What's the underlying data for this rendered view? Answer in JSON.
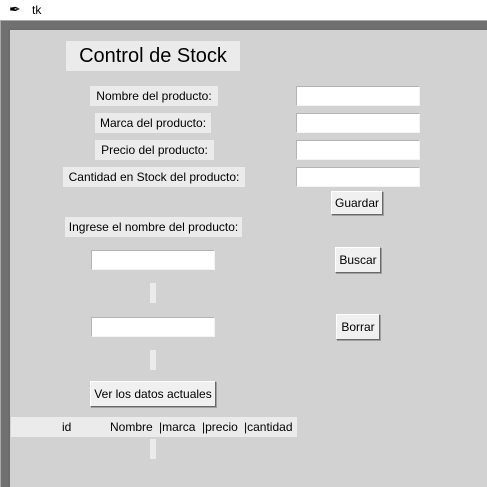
{
  "window": {
    "title": "tk",
    "icon": "feather-icon"
  },
  "form": {
    "title": "Control de Stock",
    "labels": {
      "nombre": "Nombre del producto:",
      "marca": "Marca del producto:",
      "precio": "Precio del producto:",
      "cantidad": "Cantidad en Stock del producto:"
    },
    "inputs": {
      "nombre": "",
      "marca": "",
      "precio": "",
      "cantidad": ""
    },
    "guardar_label": "Guardar",
    "search_prompt": "Ingrese el nombre del producto:",
    "buscar_input": "",
    "buscar_label": "Buscar",
    "borrar_input": "",
    "borrar_label": "Borrar",
    "ver_label": "Ver los datos actuales"
  },
  "table": {
    "columns": [
      "id",
      "Nombre",
      "|marca",
      "|precio",
      "|cantidad"
    ]
  }
}
